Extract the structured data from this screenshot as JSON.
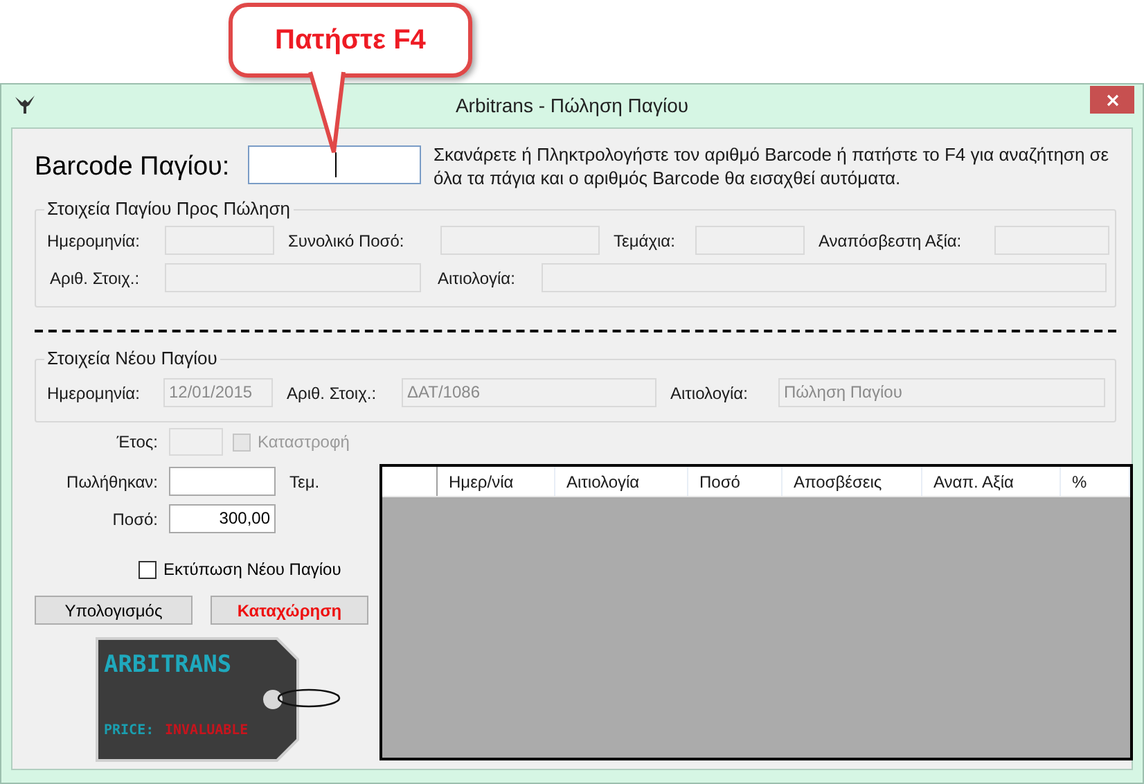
{
  "callout": {
    "text": "Πατήστε F4"
  },
  "window": {
    "title": "Arbitrans - Πώληση Παγίου"
  },
  "barcode": {
    "label": "Barcode Παγίου:",
    "focused": true,
    "hint": "Σκανάρετε ή Πληκτρολογήστε τον αριθμό Barcode ή πατήστε το F4 για αναζήτηση σε όλα τα πάγια και ο αριθμός Barcode θα εισαχθεί αυτόματα."
  },
  "asset_for_sale": {
    "title": "Στοιχεία Παγίου Προς Πώληση",
    "rows": [
      {
        "fields": [
          {
            "label": "Ημερομηνία:",
            "disabled": true
          },
          {
            "label": "Συνολικό Ποσό:",
            "disabled": true
          },
          {
            "label": "Τεμάχια:",
            "disabled": true
          },
          {
            "label": "Αναπόσβεστη Αξία:",
            "disabled": true
          }
        ]
      },
      {
        "fields": [
          {
            "label": "Αριθ. Στοιχ.:",
            "disabled": true
          },
          {
            "label": "Αιτιολογία:",
            "disabled": true
          }
        ]
      }
    ]
  },
  "new_asset": {
    "title": "Στοιχεία Νέου Παγίου",
    "fields": [
      {
        "label": "Ημερομηνία:",
        "value": "12/01/2015",
        "disabled": true
      },
      {
        "label": "Αριθ. Στοιχ.:",
        "value": "ΔΑΤ/1086",
        "disabled": true
      },
      {
        "label": "Αιτιολογία:",
        "value": "Πώληση Παγίου",
        "disabled": true
      }
    ]
  },
  "year": {
    "label": "Έτος:",
    "disabled": true
  },
  "destruction": {
    "label": "Καταστροφή",
    "checked": false,
    "disabled": true
  },
  "sold": {
    "label": "Πωλήθηκαν:",
    "unit": "Τεμ.",
    "disabled": false
  },
  "amount": {
    "label": "Ποσό:",
    "value": "300,00",
    "disabled": false
  },
  "print_new": {
    "label": "Εκτύπωση Νέου Παγίου",
    "checked": false,
    "disabled": false
  },
  "buttons": [
    {
      "label": "Υπολογισμός",
      "kind": "normal"
    },
    {
      "label": "Καταχώρηση",
      "kind": "primary"
    }
  ],
  "logo": {
    "name": "ARBITRANS",
    "price_label": "PRICE:",
    "price_value": "INVALUABLE"
  },
  "table": {
    "columns": [
      "Ημερ/νία",
      "Αιτιολογία",
      "Ποσό",
      "Αποσβέσεις",
      "Αναπ. Αξία",
      "%"
    ]
  }
}
